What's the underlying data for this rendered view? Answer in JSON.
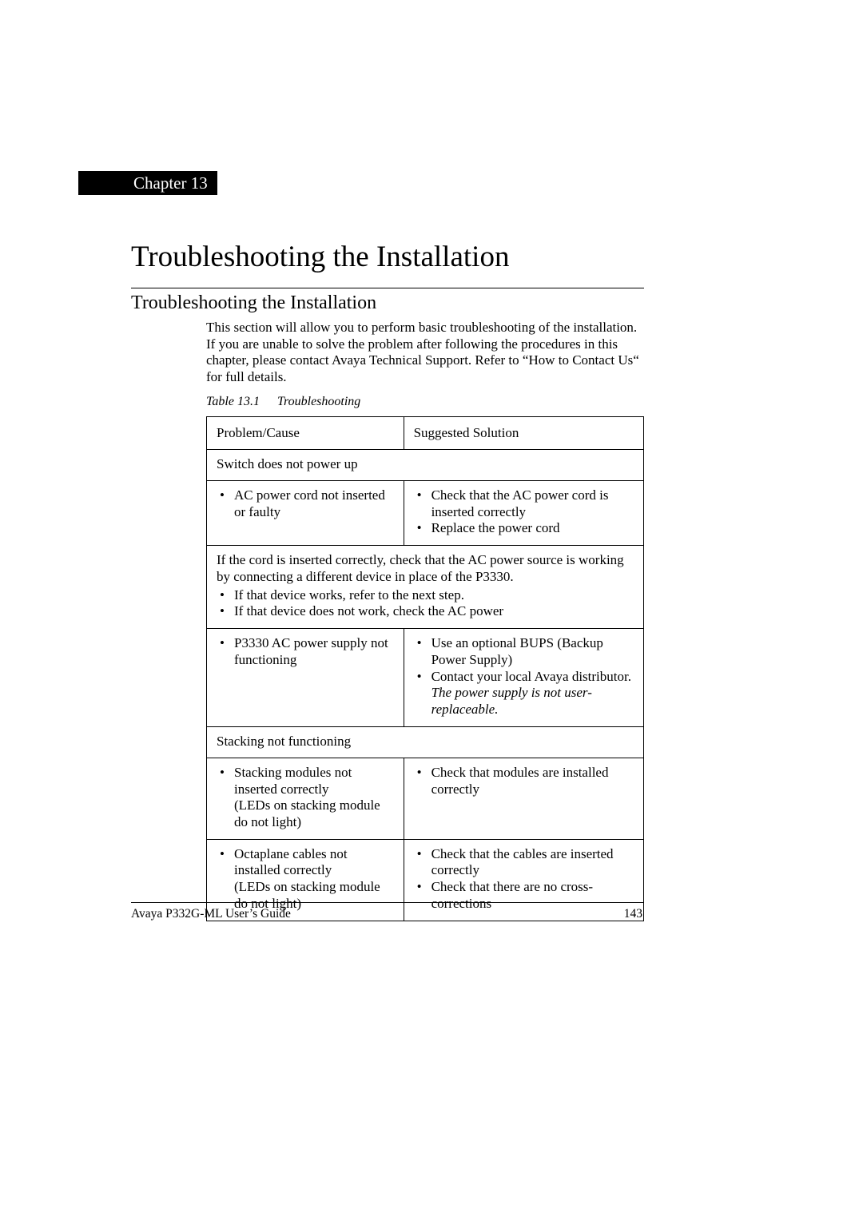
{
  "chapter_label": "Chapter 13",
  "doc_title": "Troubleshooting the Installation",
  "section_heading": "Troubleshooting the Installation",
  "intro": "This section will allow you to perform basic troubleshooting of the installation. If you are unable to solve the problem after following the procedures in this chapter, please contact Avaya Technical Support. Refer to “How to Contact Us“ for full details.",
  "table_caption_num": "Table 13.1",
  "table_caption_name": "Troubleshooting",
  "table": {
    "header_problem": "Problem/Cause",
    "header_solution": "Suggested Solution",
    "rows": [
      {
        "type": "span",
        "heading": "Switch does not power up"
      },
      {
        "type": "pair",
        "problem": [
          "AC power cord not inserted or faulty"
        ],
        "solution": [
          "Check that the AC power cord is inserted correctly",
          "Replace the power cord"
        ]
      },
      {
        "type": "span_text",
        "text": "If the cord is inserted correctly, check that the AC power source is working by connecting a different device in place of the P3330.",
        "bullets": [
          "If that device works, refer to the next step.",
          "If that device does not work, check the AC power"
        ]
      },
      {
        "type": "pair",
        "problem": [
          "P3330 AC power supply not functioning"
        ],
        "solution_rich": [
          {
            "text": "Use an optional BUPS (Backup Power Supply)"
          },
          {
            "text": "Contact your local Avaya distributor. ",
            "italic_suffix": "The power supply is not user-replaceable."
          }
        ]
      },
      {
        "type": "span",
        "heading": "Stacking not functioning"
      },
      {
        "type": "pair",
        "problem": [
          "Stacking modules not inserted correctly\n(LEDs on stacking module do not light)"
        ],
        "solution": [
          "Check that modules are installed correctly"
        ]
      },
      {
        "type": "pair",
        "problem": [
          "Octaplane cables not installed correctly\n(LEDs on stacking module do not light)"
        ],
        "solution": [
          "Check that the cables are inserted correctly",
          "Check that there are no cross-corrections"
        ]
      }
    ]
  },
  "footer_left": "Avaya P332G-ML User’s Guide",
  "footer_right": "143"
}
